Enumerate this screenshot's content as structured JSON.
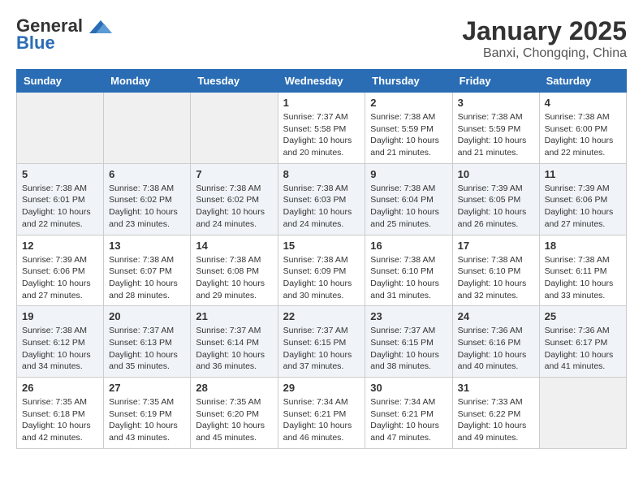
{
  "logo": {
    "line1": "General",
    "line2": "Blue"
  },
  "title": "January 2025",
  "subtitle": "Banxi, Chongqing, China",
  "days_of_week": [
    "Sunday",
    "Monday",
    "Tuesday",
    "Wednesday",
    "Thursday",
    "Friday",
    "Saturday"
  ],
  "weeks": [
    [
      {
        "day": "",
        "info": ""
      },
      {
        "day": "",
        "info": ""
      },
      {
        "day": "",
        "info": ""
      },
      {
        "day": "1",
        "info": "Sunrise: 7:37 AM\nSunset: 5:58 PM\nDaylight: 10 hours and 20 minutes."
      },
      {
        "day": "2",
        "info": "Sunrise: 7:38 AM\nSunset: 5:59 PM\nDaylight: 10 hours and 21 minutes."
      },
      {
        "day": "3",
        "info": "Sunrise: 7:38 AM\nSunset: 5:59 PM\nDaylight: 10 hours and 21 minutes."
      },
      {
        "day": "4",
        "info": "Sunrise: 7:38 AM\nSunset: 6:00 PM\nDaylight: 10 hours and 22 minutes."
      }
    ],
    [
      {
        "day": "5",
        "info": "Sunrise: 7:38 AM\nSunset: 6:01 PM\nDaylight: 10 hours and 22 minutes."
      },
      {
        "day": "6",
        "info": "Sunrise: 7:38 AM\nSunset: 6:02 PM\nDaylight: 10 hours and 23 minutes."
      },
      {
        "day": "7",
        "info": "Sunrise: 7:38 AM\nSunset: 6:02 PM\nDaylight: 10 hours and 24 minutes."
      },
      {
        "day": "8",
        "info": "Sunrise: 7:38 AM\nSunset: 6:03 PM\nDaylight: 10 hours and 24 minutes."
      },
      {
        "day": "9",
        "info": "Sunrise: 7:38 AM\nSunset: 6:04 PM\nDaylight: 10 hours and 25 minutes."
      },
      {
        "day": "10",
        "info": "Sunrise: 7:39 AM\nSunset: 6:05 PM\nDaylight: 10 hours and 26 minutes."
      },
      {
        "day": "11",
        "info": "Sunrise: 7:39 AM\nSunset: 6:06 PM\nDaylight: 10 hours and 27 minutes."
      }
    ],
    [
      {
        "day": "12",
        "info": "Sunrise: 7:39 AM\nSunset: 6:06 PM\nDaylight: 10 hours and 27 minutes."
      },
      {
        "day": "13",
        "info": "Sunrise: 7:38 AM\nSunset: 6:07 PM\nDaylight: 10 hours and 28 minutes."
      },
      {
        "day": "14",
        "info": "Sunrise: 7:38 AM\nSunset: 6:08 PM\nDaylight: 10 hours and 29 minutes."
      },
      {
        "day": "15",
        "info": "Sunrise: 7:38 AM\nSunset: 6:09 PM\nDaylight: 10 hours and 30 minutes."
      },
      {
        "day": "16",
        "info": "Sunrise: 7:38 AM\nSunset: 6:10 PM\nDaylight: 10 hours and 31 minutes."
      },
      {
        "day": "17",
        "info": "Sunrise: 7:38 AM\nSunset: 6:10 PM\nDaylight: 10 hours and 32 minutes."
      },
      {
        "day": "18",
        "info": "Sunrise: 7:38 AM\nSunset: 6:11 PM\nDaylight: 10 hours and 33 minutes."
      }
    ],
    [
      {
        "day": "19",
        "info": "Sunrise: 7:38 AM\nSunset: 6:12 PM\nDaylight: 10 hours and 34 minutes."
      },
      {
        "day": "20",
        "info": "Sunrise: 7:37 AM\nSunset: 6:13 PM\nDaylight: 10 hours and 35 minutes."
      },
      {
        "day": "21",
        "info": "Sunrise: 7:37 AM\nSunset: 6:14 PM\nDaylight: 10 hours and 36 minutes."
      },
      {
        "day": "22",
        "info": "Sunrise: 7:37 AM\nSunset: 6:15 PM\nDaylight: 10 hours and 37 minutes."
      },
      {
        "day": "23",
        "info": "Sunrise: 7:37 AM\nSunset: 6:15 PM\nDaylight: 10 hours and 38 minutes."
      },
      {
        "day": "24",
        "info": "Sunrise: 7:36 AM\nSunset: 6:16 PM\nDaylight: 10 hours and 40 minutes."
      },
      {
        "day": "25",
        "info": "Sunrise: 7:36 AM\nSunset: 6:17 PM\nDaylight: 10 hours and 41 minutes."
      }
    ],
    [
      {
        "day": "26",
        "info": "Sunrise: 7:35 AM\nSunset: 6:18 PM\nDaylight: 10 hours and 42 minutes."
      },
      {
        "day": "27",
        "info": "Sunrise: 7:35 AM\nSunset: 6:19 PM\nDaylight: 10 hours and 43 minutes."
      },
      {
        "day": "28",
        "info": "Sunrise: 7:35 AM\nSunset: 6:20 PM\nDaylight: 10 hours and 45 minutes."
      },
      {
        "day": "29",
        "info": "Sunrise: 7:34 AM\nSunset: 6:21 PM\nDaylight: 10 hours and 46 minutes."
      },
      {
        "day": "30",
        "info": "Sunrise: 7:34 AM\nSunset: 6:21 PM\nDaylight: 10 hours and 47 minutes."
      },
      {
        "day": "31",
        "info": "Sunrise: 7:33 AM\nSunset: 6:22 PM\nDaylight: 10 hours and 49 minutes."
      },
      {
        "day": "",
        "info": ""
      }
    ]
  ]
}
